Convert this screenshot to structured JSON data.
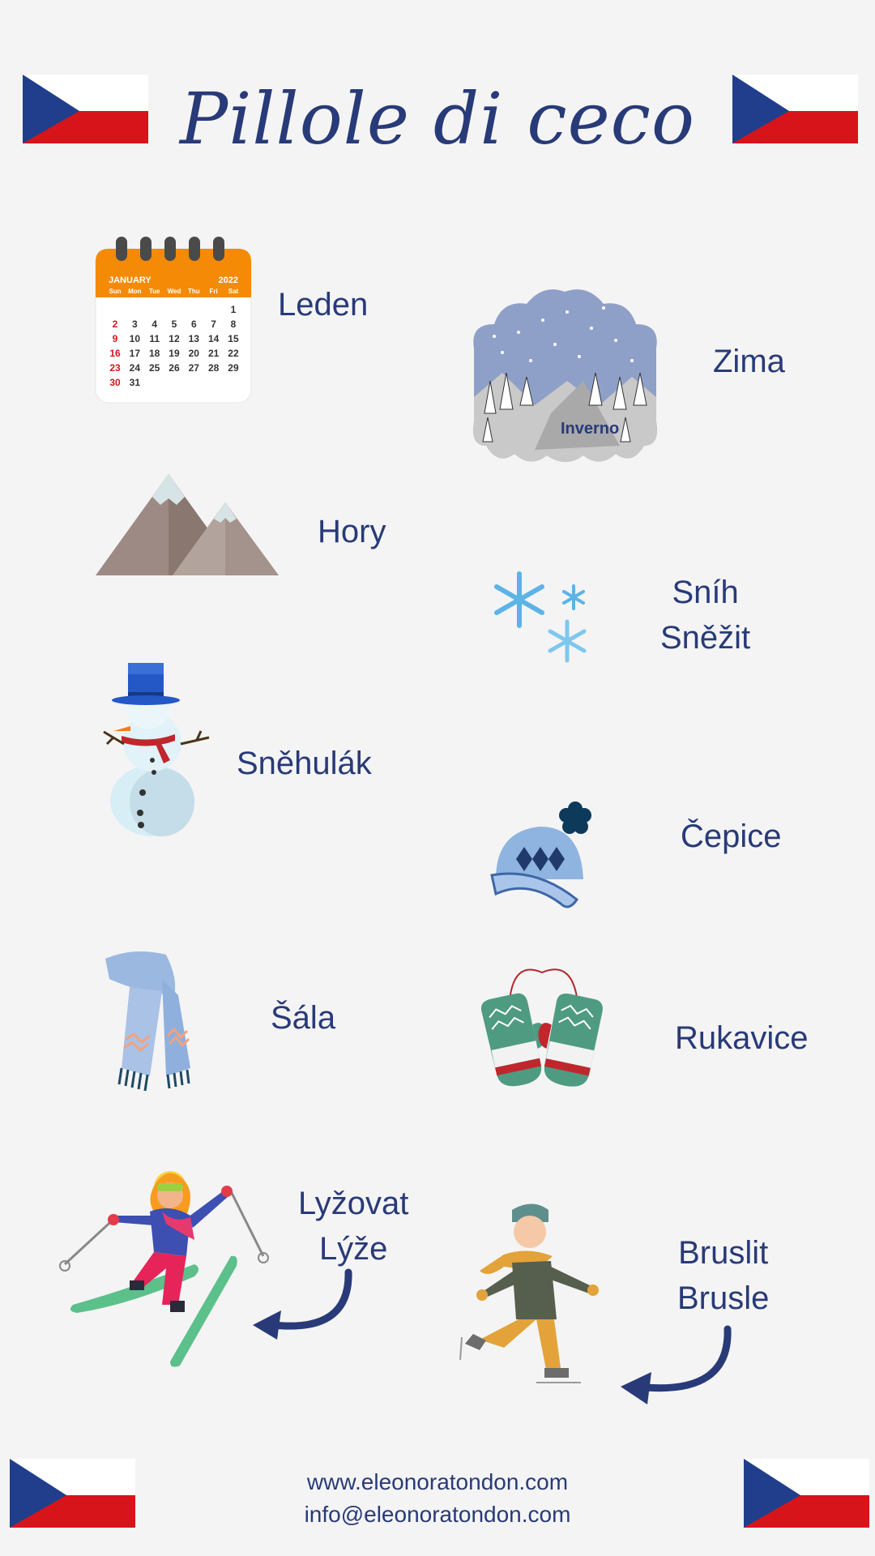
{
  "title": "Pillole di ceco",
  "items": {
    "leden": "Leden",
    "zima": "Zima",
    "inverno_label": "Inverno",
    "hory": "Hory",
    "snih": "Sníh",
    "snezit": "Sněžit",
    "snehulak": "Sněhulák",
    "cepice": "Čepice",
    "sala": "Šála",
    "rukavice": "Rukavice",
    "lyzovat": "Lyžovat",
    "lyze": "Lýže",
    "bruslit": "Bruslit",
    "brusle": "Brusle"
  },
  "calendar": {
    "month": "JANUARY",
    "year": "2022",
    "weekdays": [
      "Sun",
      "Mon",
      "Tue",
      "Wed",
      "Thu",
      "Fri",
      "Sat"
    ],
    "rows": [
      [
        "",
        "",
        "",
        "",
        "",
        "",
        "1"
      ],
      [
        "2",
        "3",
        "4",
        "5",
        "6",
        "7",
        "8"
      ],
      [
        "9",
        "10",
        "11",
        "12",
        "13",
        "14",
        "15"
      ],
      [
        "16",
        "17",
        "18",
        "19",
        "20",
        "21",
        "22"
      ],
      [
        "23",
        "24",
        "25",
        "26",
        "27",
        "28",
        "29"
      ],
      [
        "30",
        "31",
        "",
        "",
        "",
        "",
        ""
      ]
    ]
  },
  "footer": {
    "website": "www.eleonoratondon.com",
    "email": "info@eleonoratondon.com"
  },
  "colors": {
    "text": "#283a78",
    "background": "#f4f4f4",
    "flag_blue": "#213e8c",
    "flag_red": "#d7141a",
    "calendar_orange": "#f58a07"
  }
}
